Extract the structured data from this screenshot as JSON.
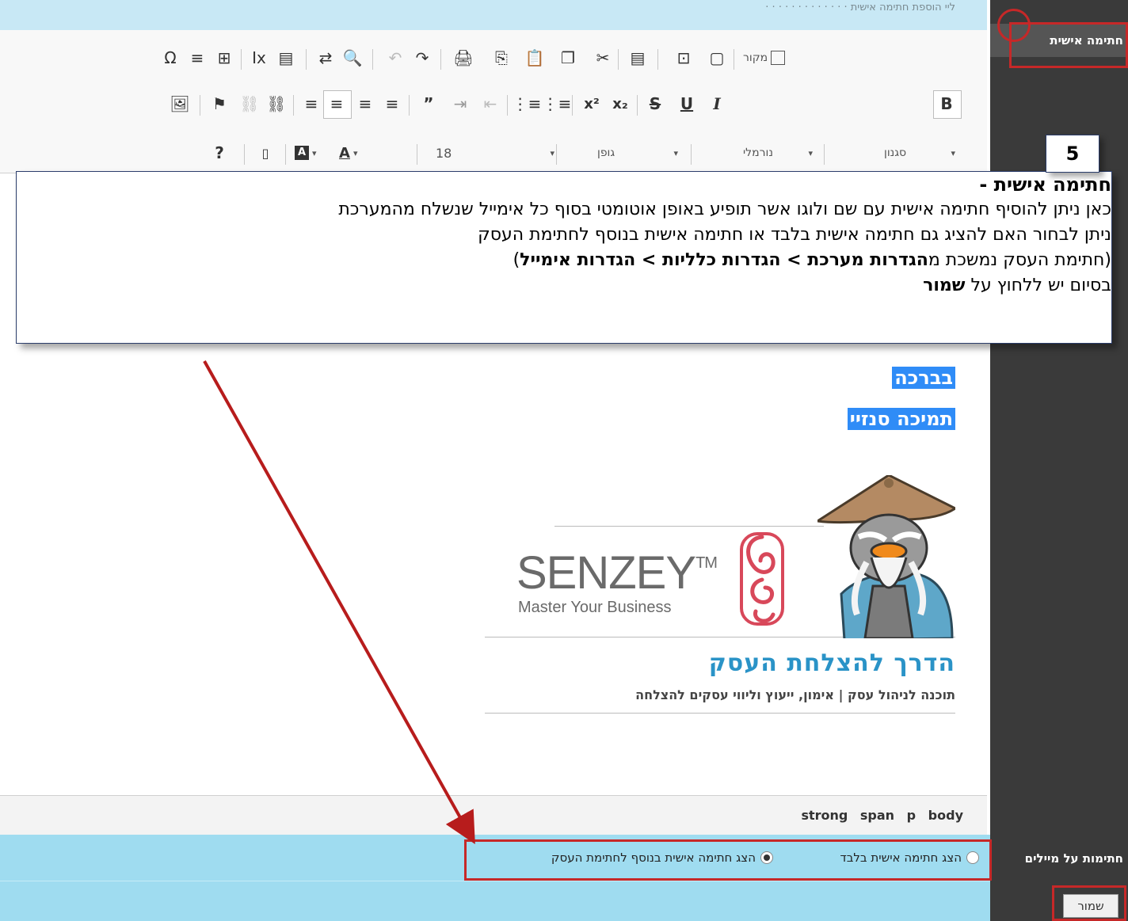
{
  "top_strip": {
    "faint_text": "ליי הוספת חתימה אישית · · · · · · · · · · · · ·"
  },
  "sidebar": {
    "active_item": "חתימה אישית",
    "bottom_label": "חתימות על מיילים"
  },
  "toolbar": {
    "row1": [
      "Ω",
      "≡",
      "⊞",
      "Ix",
      "▤",
      "⇄",
      "🔍",
      "↶",
      "↷",
      "🖨",
      "⎘",
      "📋",
      "❐",
      "✂",
      "▤",
      "⊡",
      "▢"
    ],
    "source_label": "מקור",
    "row2": [
      "🖼",
      "⚑",
      "⛓",
      "⛓",
      "≡",
      "≡",
      "≡",
      "≡",
      "”",
      "⇥",
      "⇤",
      "⋮≡",
      "⋮≡",
      "x²",
      "x₂",
      "S",
      "U",
      "I",
      "B"
    ],
    "row3": {
      "help": "?",
      "size_value": "18",
      "font_label": "גופן",
      "format_label": "נורמלי",
      "style_label": "סגנון"
    }
  },
  "editor": {
    "sig_line1": "בברכה",
    "sig_line2": "תמיכה סנזיי",
    "logo_text": "SENZEY",
    "logo_tm": "TM",
    "logo_tagline": "Master Your Business",
    "slogan_main": "הדרך להצלחת העסק",
    "slogan_sub": "תוכנה לניהול עסק | אימון, ייעוץ וליווי עסקים להצלחה"
  },
  "elements_path": "strong span p body",
  "options": {
    "radio_personal_only": "הצג חתימה אישית בלבד",
    "radio_personal_plus_business": "הצג חתימה אישית בנוסף לחתימת העסק",
    "selected": "radio_personal_plus_business"
  },
  "save_label": "שמור",
  "callout": {
    "step_number": "5",
    "title": "חתימה אישית -",
    "line1": "כאן ניתן להוסיף חתימה אישית עם שם ולוגו אשר תופיע באופן אוטומטי בסוף כל אימייל שנשלח מהמערכת",
    "line2": "ניתן לבחור האם להציג גם חתימה אישית בלבד או חתימה אישית בנוסף לחתימת העסק",
    "line3_prefix": "(חתימת העסק נמשכת מ",
    "line3_bold": "הגדרות מערכת > הגדרות כלליות > הגדרות אימייל",
    "line3_suffix": ")",
    "line4_prefix": "בסיום יש ללחוץ על ",
    "line4_bold": "שמור"
  },
  "colors": {
    "sidebar": "#3a3a3a",
    "band": "#9fdcf0",
    "highlight": "#2f8cf7",
    "annotation": "#c62828",
    "slogan": "#2a93c7"
  }
}
